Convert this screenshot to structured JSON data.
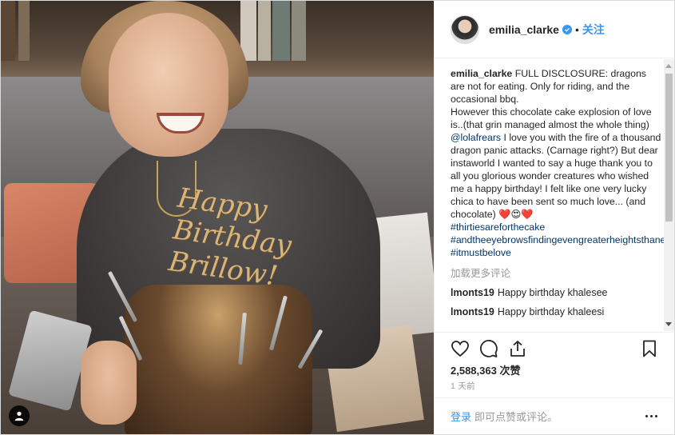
{
  "post": {
    "username": "emilia_clarke",
    "separator": "•",
    "follow_label": "关注",
    "caption": {
      "username": "emilia_clarke",
      "part1": "FULL DISCLOSURE: dragons are not for eating. Only for riding, and the occasional bbq.",
      "part2": "However this chocolate cake explosion of love is..(that grin managed almost the whole thing)",
      "mention": "@lolafrears",
      "part3": "I love you with the fire of a thousand dragon panic attacks. (Carnage right?) But dear instaworld I wanted to say a huge thank you to all you glorious wonder creatures who wished me a happy birthday! I felt like one very lucky chica to have been sent so much love... (and chocolate) ❤️😍❤️",
      "hashtags": [
        "#thirtiesareforthecake",
        "#andtheeyebrowsfindingevengreaterheightsthaneverbefore",
        "#itmustbelove"
      ]
    },
    "load_more": "加载更多评论",
    "comments": [
      {
        "user": "lmonts19",
        "text": "Happy birthday khalesee"
      },
      {
        "user": "lmonts19",
        "text": "Happy birthday khaleesi"
      }
    ],
    "likes_count": "2,588,363",
    "likes_label": "次赞",
    "time": "1 天前",
    "login_link": "登录",
    "login_text": "即可点赞或评论。",
    "photo_topper": "Happy Birthday Brillow!"
  },
  "icons": {
    "verified": "verified-badge-icon",
    "like": "heart-icon",
    "comment": "comment-bubble-icon",
    "share": "share-icon",
    "save": "bookmark-icon",
    "more": "more-options-icon",
    "user_tag": "person-icon"
  },
  "colors": {
    "link_blue": "#3897f0",
    "hashtag_navy": "#003569",
    "muted": "#999999",
    "text": "#262626"
  }
}
